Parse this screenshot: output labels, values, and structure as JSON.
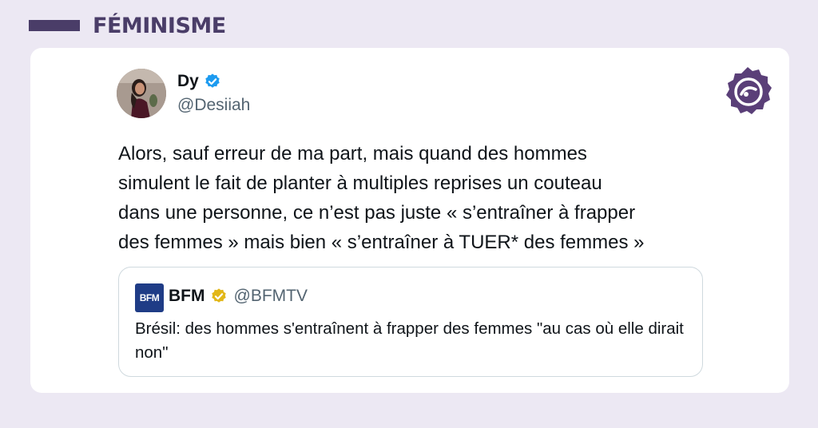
{
  "header": {
    "title": "FÉMINISME",
    "accent_color": "#4a3d68"
  },
  "tweet": {
    "author_name": "Dy",
    "author_handle": "@Desiiah",
    "verified_icon": "verified-blue-check-icon",
    "text": "Alors, sauf erreur de ma part, mais quand des hommes\nsimulent le fait de planter à multiples reprises un couteau\ndans une personne, ce n’est pas juste « s’entraîner à frapper\ndes femmes » mais bien « s’entraîner à TUER* des femmes »"
  },
  "quote": {
    "logo_text": "BFM",
    "author_name": "BFM",
    "author_handle": "@BFMTV",
    "badge_icon": "verified-gold-badge-icon",
    "text": "Brésil: des hommes s'entraînent à frapper des femmes \"au cas où elle dirait non\""
  },
  "colors": {
    "background": "#ece8f3",
    "verified_blue": "#1d9bf0",
    "verified_gold": "#e2b719",
    "muted_text": "#536471",
    "bfm_blue": "#1f3c86"
  }
}
